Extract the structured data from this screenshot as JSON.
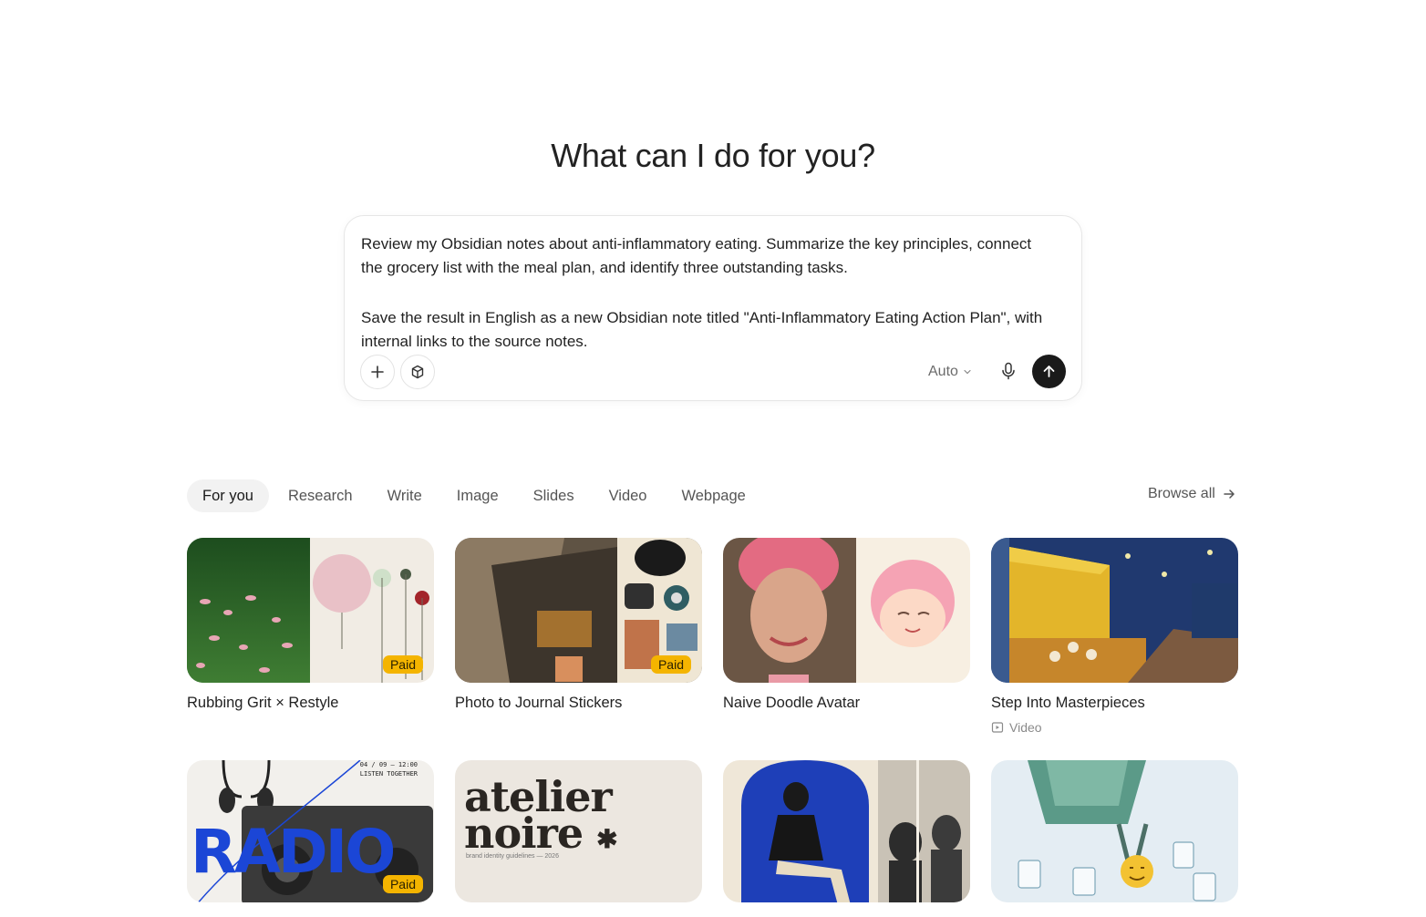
{
  "hero": {
    "title": "What can I do for you?"
  },
  "composer": {
    "prompt_paragraph_1": "Review my Obsidian notes about anti-inflammatory eating. Summarize the key principles, connect the grocery list with the meal plan, and identify three outstanding tasks.",
    "prompt_paragraph_2": "Save the result in English as a new Obsidian note titled \"Anti-Inflammatory Eating Action Plan\", with internal links to the source notes.",
    "mode": "Auto",
    "icons": {
      "add": "plus-icon",
      "connectors": "cube-icon",
      "mode": "chevron-down-icon",
      "voice": "microphone-icon",
      "send": "arrow-up-icon"
    }
  },
  "tabs": {
    "items": [
      "For you",
      "Research",
      "Write",
      "Image",
      "Slides",
      "Video",
      "Webpage"
    ],
    "active": "For you",
    "browse_all": "Browse all"
  },
  "cards": [
    {
      "title": "Rubbing Grit × Restyle",
      "badge": "Paid"
    },
    {
      "title": "Photo to Journal Stickers",
      "badge": "Paid"
    },
    {
      "title": "Naive Doodle Avatar"
    },
    {
      "title": "Step Into Masterpieces",
      "subtitle": "Video"
    },
    {
      "badge": "Paid",
      "art_text": {
        "word": "RADIO",
        "top_line_1": "04 / 09 — 12:00",
        "top_line_2": "LISTEN TOGETHER"
      }
    },
    {
      "art_text": {
        "word_1": "atelier",
        "word_2": "noire",
        "mark": "✱",
        "caption": "brand identity guidelines — 2026"
      }
    },
    {},
    {}
  ],
  "colors": {
    "accent": "#1a1a1a",
    "paid_badge": "#f4b400",
    "active_tab_bg": "#f2f2f2"
  }
}
